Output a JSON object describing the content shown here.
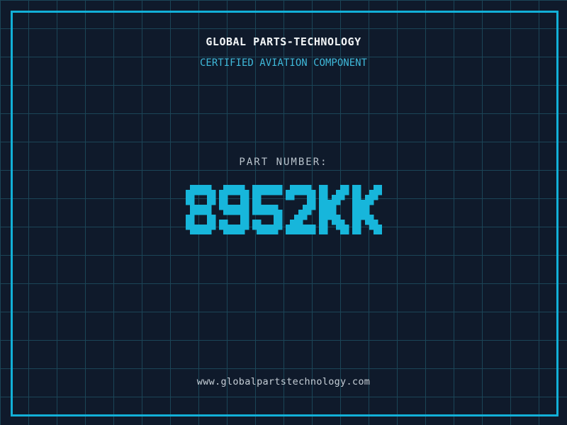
{
  "header": {
    "title": "GLOBAL PARTS-TECHNOLOGY",
    "subtitle": "CERTIFIED AVIATION COMPONENT"
  },
  "part": {
    "label": "PART NUMBER:",
    "value": "8952KK"
  },
  "footer": {
    "url": "www.globalpartstechnology.com"
  },
  "colors": {
    "background": "#0f1a2b",
    "grid_line": "#1b4557",
    "frame_accent": "#12b0d8",
    "part_number": "#17b6db",
    "title_text": "#f2f5f7",
    "subtitle_text": "#3fb9da",
    "label_text": "#b9c3cc",
    "url_text": "#c5ced6"
  }
}
